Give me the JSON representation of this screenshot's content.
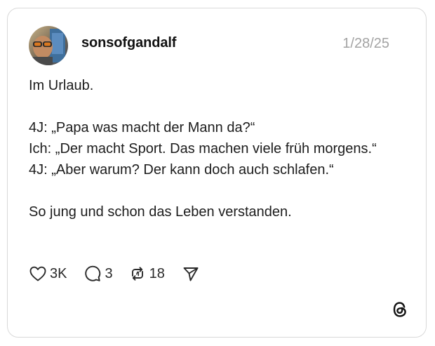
{
  "post": {
    "username": "sonsofgandalf",
    "date": "1/28/25",
    "lines": [
      "Im Urlaub.",
      "",
      "4J: „Papa was macht der Mann da?“",
      "Ich: „Der macht Sport. Das machen viele früh morgens.“",
      "4J: „Aber warum? Der kann doch auch schlafen.“",
      "",
      "So jung und schon das Leben verstanden."
    ]
  },
  "actions": {
    "likes": "3K",
    "replies": "3",
    "reposts": "18"
  },
  "icons": {
    "like": "heart-icon",
    "reply": "speech-bubble-icon",
    "repost": "repost-icon",
    "share": "send-icon",
    "brand": "threads-logo-icon"
  },
  "colors": {
    "date": "#a3a3a3",
    "border": "#d9d9d9"
  }
}
